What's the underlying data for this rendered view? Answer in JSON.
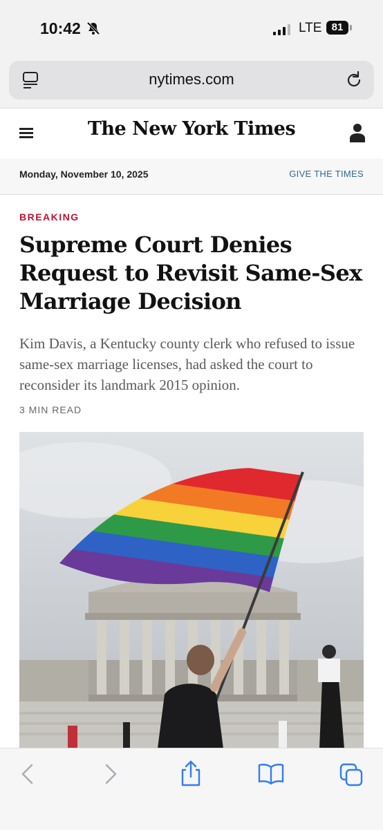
{
  "status_bar": {
    "time": "10:42",
    "network": "LTE",
    "battery": "81"
  },
  "browser": {
    "url": "nytimes.com"
  },
  "masthead": {
    "title": "The New York Times"
  },
  "date_bar": {
    "date": "Monday, November 10, 2025",
    "cta": "GIVE THE TIMES"
  },
  "article": {
    "kicker": "BREAKING",
    "headline": "Supreme Court Denies Request to Revisit Same-Sex Marriage Decision",
    "summary": "Kim Davis, a Kentucky county clerk who refused to issue same-sex marriage licenses, had asked the court to reconsider its landmark 2015 opinion.",
    "read_time": "3 MIN READ"
  },
  "colors": {
    "kicker": "#c41230",
    "link": "#326891",
    "toolbar_icon": "#2f7cf6"
  },
  "icons": [
    "bell-slash-icon",
    "signal-icon",
    "tabs-icon",
    "reload-icon",
    "menu-icon",
    "account-icon",
    "back-icon",
    "forward-icon",
    "share-icon",
    "bookmarks-icon",
    "tabs-overview-icon"
  ]
}
